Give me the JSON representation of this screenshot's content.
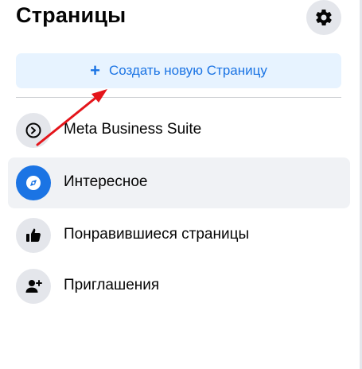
{
  "header": {
    "title": "Страницы",
    "settings_icon": "gear-icon"
  },
  "create_button": {
    "icon": "plus-icon",
    "plus_glyph": "+",
    "label": "Создать новую Страницу",
    "color": "#1b74e4",
    "background": "#e7f3ff"
  },
  "nav": {
    "items": [
      {
        "label": "Meta Business Suite",
        "icon": "meta-business-suite-icon",
        "active": false
      },
      {
        "label": "Интересное",
        "icon": "compass-icon",
        "active": true
      },
      {
        "label": "Понравившиеся страницы",
        "icon": "thumbs-up-icon",
        "active": false
      },
      {
        "label": "Приглашения",
        "icon": "add-person-icon",
        "active": false
      }
    ]
  },
  "annotation": {
    "type": "red-arrow",
    "color": "#e4151b",
    "points_to": "create_button"
  }
}
